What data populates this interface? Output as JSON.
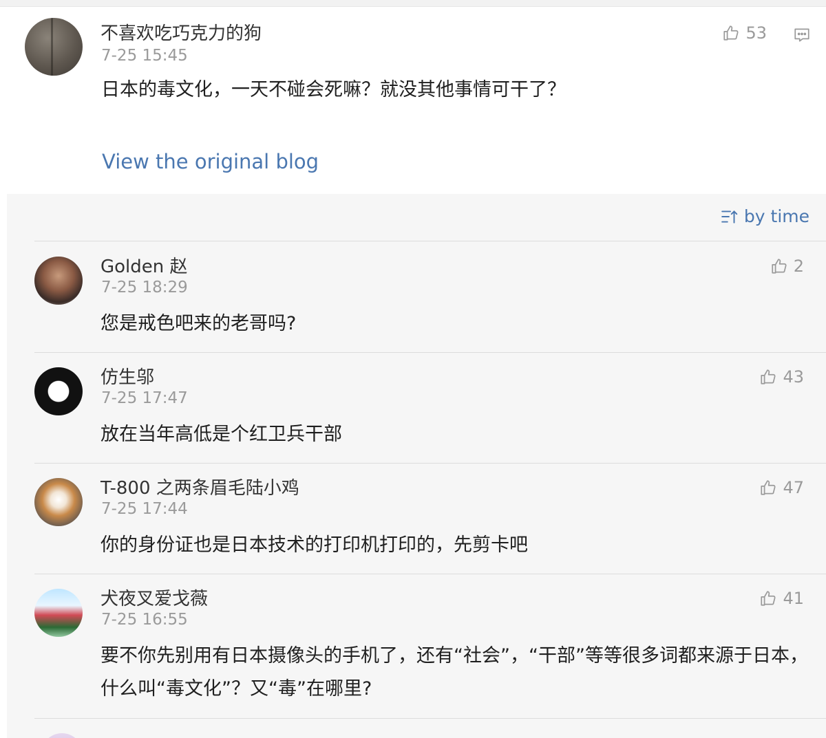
{
  "post": {
    "author": "不喜欢吃巧克力的狗",
    "time": "7-25 15:45",
    "text": "日本的毒文化，一天不碰会死嘛？就没其他事情可干了？",
    "likes": "53",
    "link": "View the original blog"
  },
  "sort": {
    "label": "by time"
  },
  "comments": [
    {
      "author": "Golden 赵",
      "time": "7-25 18:29",
      "text": "您是戒色吧来的老哥吗?",
      "likes": "2"
    },
    {
      "author": "仿生邬",
      "time": "7-25 17:47",
      "text": "放在当年高低是个红卫兵干部",
      "likes": "43"
    },
    {
      "author": "T-800 之两条眉毛陆小鸡",
      "time": "7-25 17:44",
      "text": "你的身份证也是日本技术的打印机打印的，先剪卡吧",
      "likes": "47"
    },
    {
      "author": "犬夜叉爱戈薇",
      "time": "7-25 16:55",
      "text": "要不你先别用有日本摄像头的手机了，还有“社会”，“干部”等等很多词都来源于日本，什么叫“毒文化”？又“毒”在哪里?",
      "likes": "41"
    }
  ],
  "icons": {
    "like": "thumbs-up-icon",
    "reply": "comment-icon",
    "sort": "sort-icon"
  },
  "colors": {
    "link": "#4a77b0",
    "muted": "#9a9a9a",
    "panel": "#f6f6f6"
  }
}
